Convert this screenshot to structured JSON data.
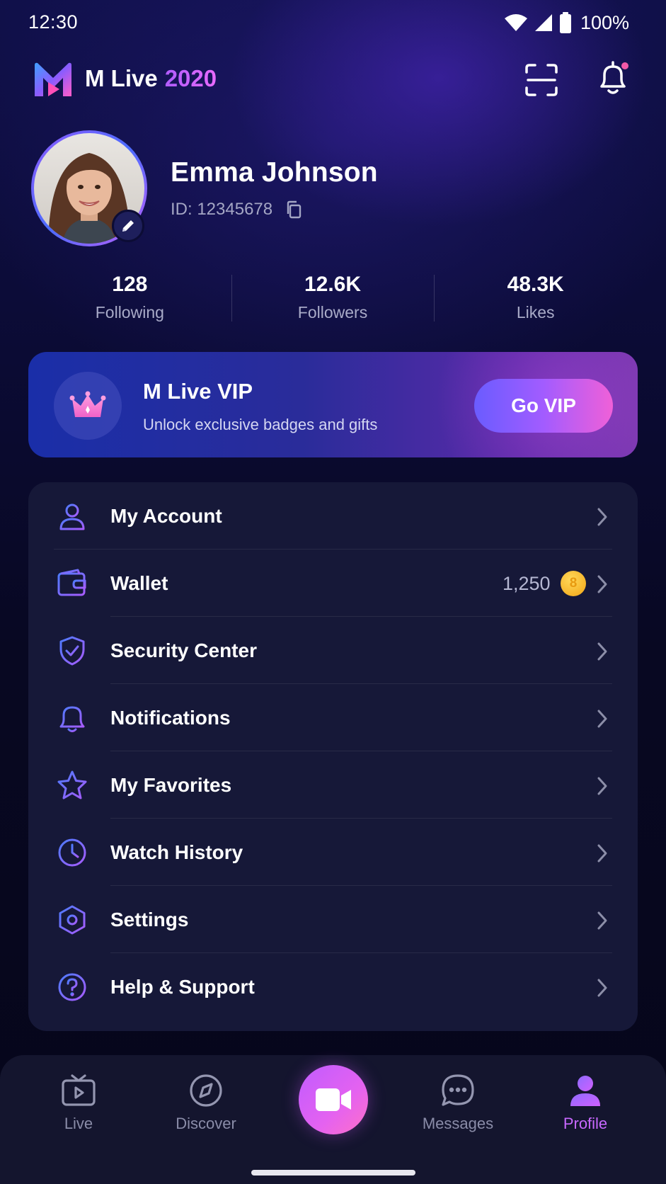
{
  "status_bar": {
    "time": "12:30",
    "battery": "100%"
  },
  "header": {
    "app_name": "M Live",
    "app_year": "2020"
  },
  "profile": {
    "name": "Emma Johnson",
    "id_text": "ID: 12345678"
  },
  "stats": [
    {
      "value": "128",
      "label": "Following"
    },
    {
      "value": "12.6K",
      "label": "Followers"
    },
    {
      "value": "48.3K",
      "label": "Likes"
    }
  ],
  "vip": {
    "title": "M Live VIP",
    "subtitle": "Unlock exclusive badges and gifts",
    "button": "Go VIP"
  },
  "menu": [
    {
      "label": "My Account",
      "icon": "user-icon"
    },
    {
      "label": "Wallet",
      "icon": "wallet-icon",
      "value": "1,250",
      "badge": "8"
    },
    {
      "label": "Security Center",
      "icon": "shield-check-icon"
    },
    {
      "label": "Notifications",
      "icon": "bell-icon"
    },
    {
      "label": "My Favorites",
      "icon": "star-icon"
    },
    {
      "label": "Watch History",
      "icon": "clock-icon"
    },
    {
      "label": "Settings",
      "icon": "settings-hexagon-icon"
    },
    {
      "label": "Help & Support",
      "icon": "help-circle-icon"
    }
  ],
  "bottom_nav": [
    {
      "label": "Live",
      "icon": "tv-play-icon",
      "active": false
    },
    {
      "label": "Discover",
      "icon": "compass-icon",
      "active": false
    },
    {
      "label": "",
      "icon": "video-camera-icon",
      "active": false
    },
    {
      "label": "Messages",
      "icon": "chat-bubble-icon",
      "active": false
    },
    {
      "label": "Profile",
      "icon": "person-icon",
      "active": true
    }
  ],
  "colors": {
    "accent_purple": "#c868ff",
    "accent_blue": "#4b6bff",
    "notification_dot": "#f25aa8",
    "card_bg": "#161838",
    "coin": "#f2b322"
  }
}
